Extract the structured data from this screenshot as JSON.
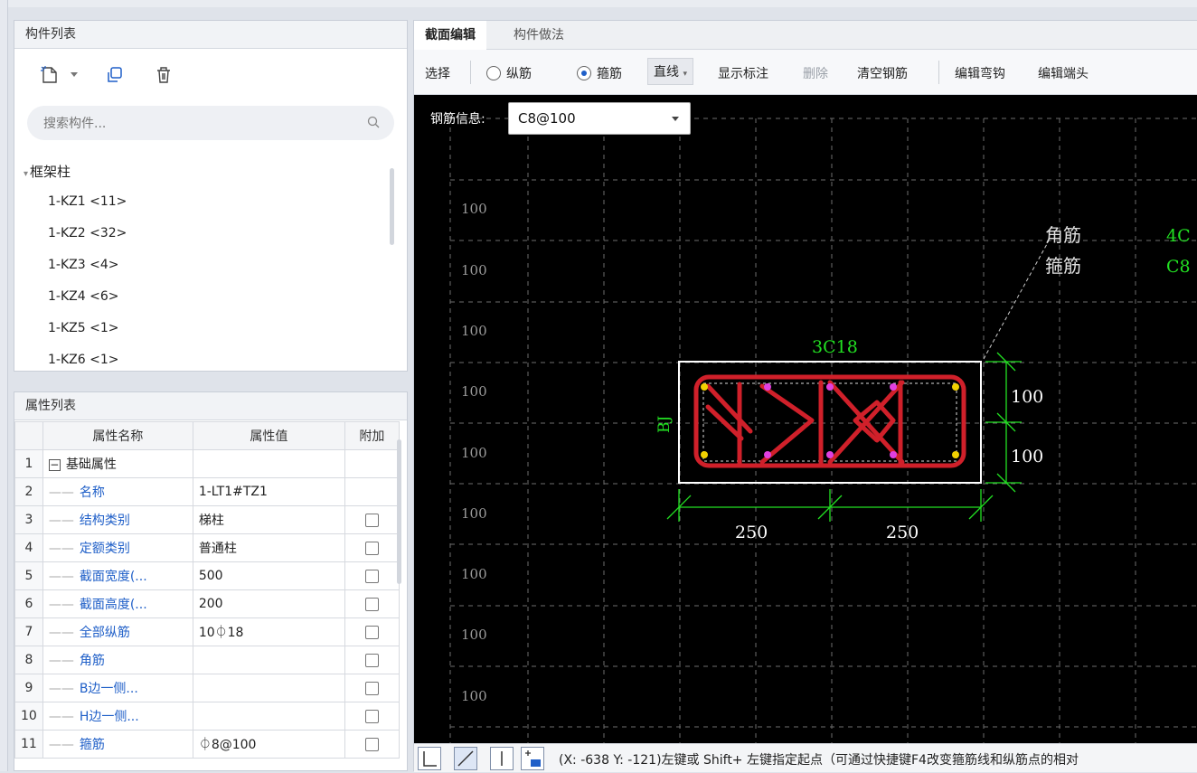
{
  "component_panel": {
    "title": "构件列表",
    "search_placeholder": "搜索构件...",
    "group": "框架柱",
    "items": [
      "1-KZ1 <11>",
      "1-KZ2 <32>",
      "1-KZ3 <4>",
      "1-KZ4 <6>",
      "1-KZ5 <1>",
      "1-KZ6 <1>"
    ]
  },
  "property_panel": {
    "title": "属性列表",
    "headers": [
      "属性名称",
      "属性值",
      "附加"
    ],
    "rows": [
      {
        "num": "1",
        "name": "基础属性",
        "value": "",
        "group": true
      },
      {
        "num": "2",
        "name": "名称",
        "value": "1-LT1#TZ1",
        "checkbox": false
      },
      {
        "num": "3",
        "name": "结构类别",
        "value": "梯柱",
        "checkbox": true
      },
      {
        "num": "4",
        "name": "定额类别",
        "value": "普通柱",
        "checkbox": true
      },
      {
        "num": "5",
        "name": "截面宽度(...",
        "value": "500",
        "checkbox": true
      },
      {
        "num": "6",
        "name": "截面高度(...",
        "value": "200",
        "checkbox": true
      },
      {
        "num": "7",
        "name": "全部纵筋",
        "value": "10⏀18",
        "checkbox": true
      },
      {
        "num": "8",
        "name": "角筋",
        "value": "",
        "checkbox": true
      },
      {
        "num": "9",
        "name": "B边一侧...",
        "value": "",
        "checkbox": true
      },
      {
        "num": "10",
        "name": "H边一侧...",
        "value": "",
        "checkbox": true
      },
      {
        "num": "11",
        "name": "箍筋",
        "value": "⏀8@100",
        "checkbox": true
      }
    ]
  },
  "editor": {
    "tabs": [
      "截面编辑",
      "构件做法"
    ],
    "tools": {
      "select": "选择",
      "longitudinal": "纵筋",
      "stirrup": "箍筋",
      "line": "直线",
      "show_label": "显示标注",
      "delete": "删除",
      "clear": "清空钢筋",
      "edit_hook": "编辑弯钩",
      "edit_end": "编辑端头"
    },
    "rebar_info_label": "钢筋信息:",
    "rebar_info_value": "C8@100",
    "drawing": {
      "grid_label": "100",
      "corner_label_1": "角筋",
      "corner_label_2": "箍筋",
      "green_1": "4C",
      "green_2": "C8",
      "top_label": "3C18",
      "side_label": "BJ",
      "dim_v1": "100",
      "dim_v2": "100",
      "dim_h1": "250",
      "dim_h2": "250"
    },
    "status_text": "(X: -638 Y: -121)左键或 Shift+ 左键指定起点（可通过快捷键F4改变箍筋线和纵筋点的相对"
  },
  "colors": {
    "accent": "#1f5fc8",
    "rebar": "#d0202a",
    "dim": "#22e022",
    "canvas": "#000000"
  }
}
